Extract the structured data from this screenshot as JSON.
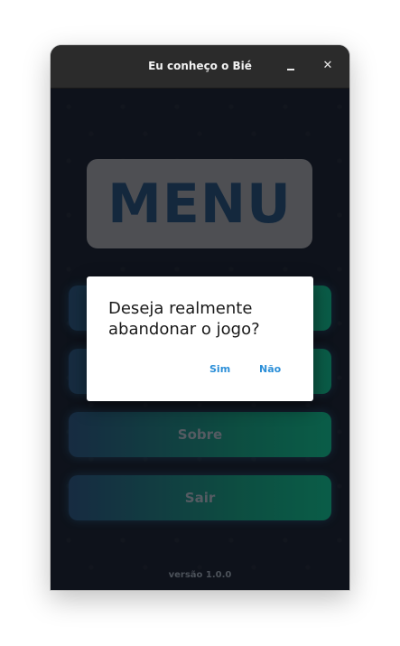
{
  "window": {
    "title": "Eu conheço o Bié",
    "minimize_icon": "minimize-icon",
    "close_icon": "close-icon",
    "close_glyph": "✕"
  },
  "menu": {
    "title": "MENU",
    "buttons": [
      {
        "label": ""
      },
      {
        "label": ""
      },
      {
        "label": "Sobre"
      },
      {
        "label": "Sair"
      }
    ],
    "version": "versão 1.0.0"
  },
  "dialog": {
    "message": "Deseja realmente abandonar o jogo?",
    "yes_label": "Sim",
    "no_label": "Não"
  },
  "colors": {
    "background": "#151b27",
    "titlebar": "#2b2b2b",
    "menu_box": "#707278",
    "menu_title": "#1d3a58",
    "button_gradient_start": "#213e5e",
    "button_gradient_end": "#0f8667",
    "dialog_button": "#2c8fd8"
  }
}
